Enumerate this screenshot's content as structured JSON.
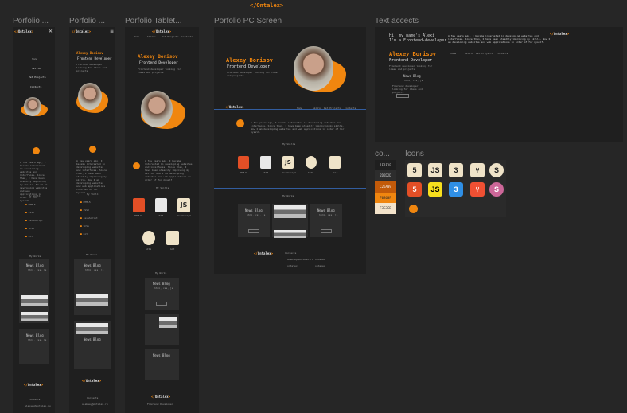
{
  "canvas": {
    "logo_title": "</Ontalex>"
  },
  "frames": {
    "mobile1": "Porfolio ...",
    "mobile2": "Porfolio ...",
    "tablet": "Porfolio Tablet...",
    "pc": "Porfolio PC Screen",
    "text_accents": "Text accects",
    "colors": "co...",
    "icons": "Icons"
  },
  "site": {
    "logo_prefix": "</",
    "logo_word": "Ontalex",
    "logo_suffix": ">",
    "name": "Alexey Borisov",
    "role": "Frontend Developer",
    "tagline": "Frontend developer looking for ideas and projects",
    "nav": [
      "Home",
      "Skills",
      "Pet Projects",
      "Contacts"
    ],
    "about": "A few years ago, I became interested in developing websites and interfaces. Since then, I have been steadily improving my skills. Now I am developing websites and web applications in order of for myself.",
    "skills_title": "My Skills",
    "skills": [
      "HTML5",
      "CSS3",
      "JavaScript",
      "SCSS",
      "Git"
    ],
    "works_title": "My Works",
    "work_title": "News Blog",
    "work_sub": "html, css, js",
    "work_btn": "Look at",
    "contacts_title": "Contacts",
    "contact_email": "aleksey@ontalex.ru",
    "contact_git": "ontalex",
    "contact_tg": "ontalex",
    "contact_vk": "ontalex",
    "hello_line1": "Hi, my name's Alexi",
    "hello_line2": "I'm a Frontend-developer."
  },
  "colors": {
    "swatches": [
      {
        "label": "1F1F1F",
        "hex": "#1f1f1f",
        "text": "#cccccc"
      },
      {
        "label": "2D2D2D",
        "hex": "#2d2d2d",
        "text": "#cccccc"
      },
      {
        "label": "C25A09",
        "hex": "#c25a09",
        "text": "#f2f2f2"
      },
      {
        "label": "F0860F",
        "hex": "#f0860f",
        "text": "#2a2a2a"
      },
      {
        "label": "F3E3CB",
        "hex": "#f3e3cb",
        "text": "#333333"
      }
    ],
    "accent": "#f0860f",
    "background": "#262626"
  },
  "icons": [
    "html5-icon",
    "javascript-icon",
    "css3-icon",
    "git-icon",
    "scss-icon"
  ]
}
